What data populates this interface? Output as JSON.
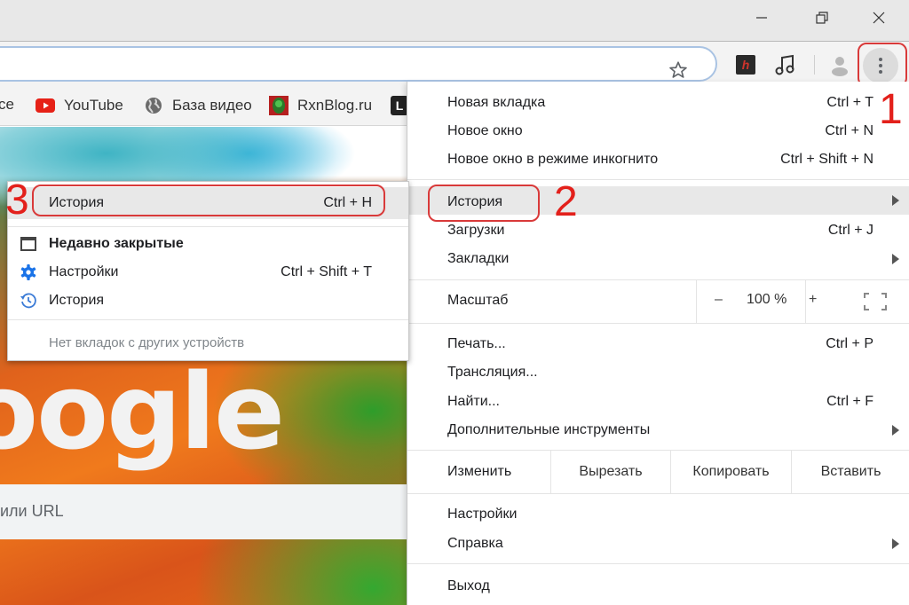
{
  "window": {
    "minimize_icon": "minimize-icon",
    "maximize_icon": "restore-icon",
    "close_icon": "close-icon"
  },
  "toolbar": {
    "omnibox_value": "",
    "star_icon": "bookmark-star-icon",
    "extensions": [
      "h-extension-icon",
      "music-extension-icon"
    ],
    "profile_icon": "profile-avatar-icon",
    "menu_icon": "three-dots-menu-icon"
  },
  "bookmarks": [
    {
      "label": "ce",
      "icon": "none"
    },
    {
      "label": "YouTube",
      "icon": "youtube-icon"
    },
    {
      "label": "База видео",
      "icon": "globe-icon"
    },
    {
      "label": "RxnBlog.ru",
      "icon": "rxnblog-icon"
    },
    {
      "label": "",
      "icon": "l-icon"
    }
  ],
  "page": {
    "logo_text": "oogle",
    "search_placeholder": "или URL"
  },
  "annotations": {
    "step1": "1",
    "step2": "2",
    "step3": "3",
    "highlight_color": "#e3201b"
  },
  "menu": {
    "group1": [
      {
        "label": "Новая вкладка",
        "shortcut": "Ctrl + T"
      },
      {
        "label": "Новое окно",
        "shortcut": "Ctrl + N"
      },
      {
        "label": "Новое окно в режиме инкогнито",
        "shortcut": "Ctrl + Shift + N"
      }
    ],
    "group2": [
      {
        "label": "История",
        "shortcut": "",
        "submenu": true,
        "active": true
      },
      {
        "label": "Загрузки",
        "shortcut": "Ctrl + J"
      },
      {
        "label": "Закладки",
        "shortcut": "",
        "submenu": true
      }
    ],
    "zoom": {
      "label": "Масштаб",
      "minus": "–",
      "value": "100 %",
      "plus": "+",
      "fullscreen_icon": "fullscreen-icon"
    },
    "group3": [
      {
        "label": "Печать...",
        "shortcut": "Ctrl + P"
      },
      {
        "label": "Трансляция...",
        "shortcut": ""
      },
      {
        "label": "Найти...",
        "shortcut": "Ctrl + F"
      },
      {
        "label": "Дополнительные инструменты",
        "shortcut": "",
        "submenu": true
      }
    ],
    "edit": {
      "label": "Изменить",
      "cut": "Вырезать",
      "copy": "Копировать",
      "paste": "Вставить"
    },
    "group4": [
      {
        "label": "Настройки",
        "shortcut": ""
      },
      {
        "label": "Справка",
        "shortcut": "",
        "submenu": true
      }
    ],
    "exit": {
      "label": "Выход"
    }
  },
  "history_submenu": {
    "history": {
      "label": "История",
      "shortcut": "Ctrl + H"
    },
    "recently_closed": {
      "label": "Недавно закрытые"
    },
    "items": [
      {
        "label": "Настройки",
        "shortcut": "Ctrl + Shift + T",
        "icon": "settings-gear-icon"
      },
      {
        "label": "История",
        "shortcut": "",
        "icon": "history-clock-icon"
      }
    ],
    "no_tabs": "Нет вкладок с других устройств"
  }
}
